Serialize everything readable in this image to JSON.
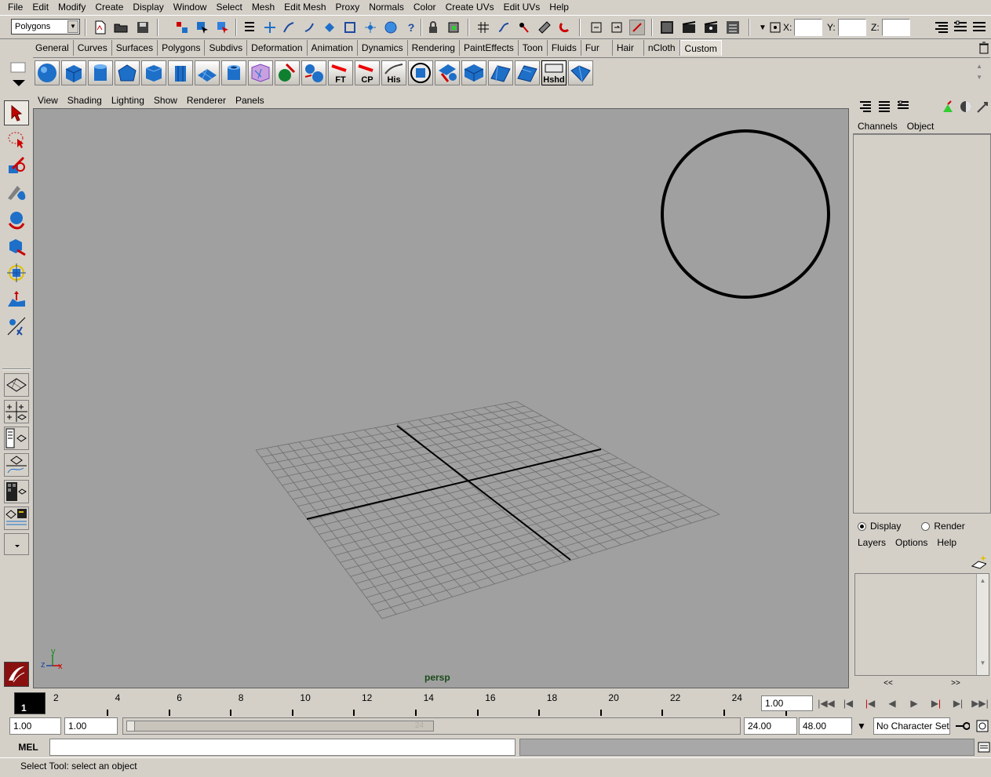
{
  "menubar": {
    "items": [
      "File",
      "Edit",
      "Modify",
      "Create",
      "Display",
      "Window",
      "Select",
      "Mesh",
      "Edit Mesh",
      "Proxy",
      "Normals",
      "Color",
      "Create UVs",
      "Edit UVs",
      "Help"
    ]
  },
  "statusline": {
    "mode": "Polygons",
    "x_label": "X:",
    "y_label": "Y:",
    "z_label": "Z:"
  },
  "shelf": {
    "tabs": [
      "General",
      "Curves",
      "Surfaces",
      "Polygons",
      "Subdivs",
      "Deformation",
      "Animation",
      "Dynamics",
      "Rendering",
      "PaintEffects",
      "Toon",
      "Fluids",
      "Fur",
      "Hair",
      "nCloth",
      "Custom"
    ],
    "active_tab": "Custom",
    "labeled_buttons": {
      "ft": "FT",
      "cp": "CP",
      "his": "His",
      "hshd": "Hshd"
    }
  },
  "panel": {
    "menus": [
      "View",
      "Shading",
      "Lighting",
      "Show",
      "Renderer",
      "Panels"
    ],
    "camera": "persp",
    "axis": {
      "x": "x",
      "y": "y",
      "z": "z"
    }
  },
  "channel_box": {
    "tabs": [
      "Channels",
      "Object"
    ]
  },
  "layers": {
    "display_label": "Display",
    "render_label": "Render",
    "mode": "Display",
    "menus": [
      "Layers",
      "Options",
      "Help"
    ],
    "nav_prev": "<<",
    "nav_next": ">>"
  },
  "timeline": {
    "ticks": [
      "2",
      "4",
      "6",
      "8",
      "10",
      "12",
      "14",
      "16",
      "18",
      "20",
      "22",
      "24"
    ],
    "current_frame_marker": "1",
    "current_time": "1.00"
  },
  "range": {
    "start_time": "1.00",
    "playback_start": "1.00",
    "range_end_label": "24",
    "playback_end": "24.00",
    "end_time": "48.00",
    "character_set": "No Character Set"
  },
  "command_line": {
    "label": "MEL"
  },
  "help_line": {
    "text": "Select Tool: select an object"
  },
  "colors": {
    "ui_bg": "#d4d0c8",
    "viewport_bg": "#a0a0a0",
    "icon_blue": "#1e6fc8",
    "camera_label": "#1a4a1a"
  }
}
